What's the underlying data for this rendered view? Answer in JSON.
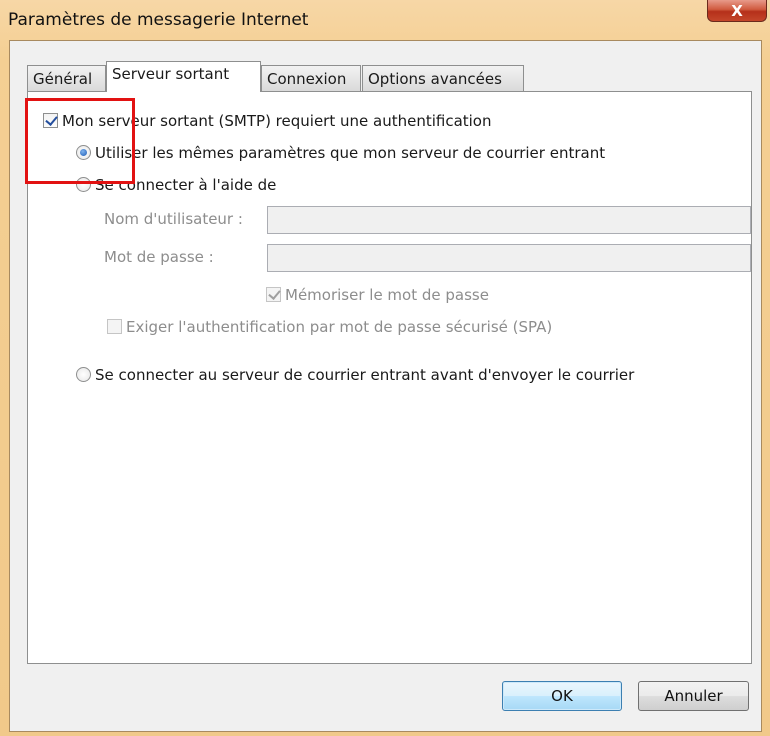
{
  "window": {
    "title": "Paramètres de messagerie Internet",
    "close_label": "X"
  },
  "tabs": [
    {
      "label": "Général",
      "active": false
    },
    {
      "label": "Serveur sortant",
      "active": true
    },
    {
      "label": "Connexion",
      "active": false
    },
    {
      "label": "Options avancées",
      "active": false
    }
  ],
  "outgoing": {
    "require_auth_label": "Mon serveur sortant (SMTP) requiert une authentification",
    "require_auth_checked": true,
    "same_settings_label": "Utiliser les mêmes paramètres que mon serveur de courrier entrant",
    "same_settings_selected": true,
    "connect_with_label": "Se connecter à l'aide de",
    "connect_with_selected": false,
    "username_label": "Nom d'utilisateur :",
    "username_value": "",
    "password_label": "Mot de passe :",
    "password_value": "",
    "remember_password_label": "Mémoriser le mot de passe",
    "remember_password_checked": true,
    "spa_label": "Exiger l'authentification par mot de passe sécurisé (SPA)",
    "spa_checked": false,
    "connect_incoming_first_label": "Se connecter au serveur de courrier entrant avant d'envoyer le courrier",
    "connect_incoming_first_selected": false
  },
  "buttons": {
    "ok_label": "OK",
    "cancel_label": "Annuler"
  },
  "colors": {
    "title_bar": "#f1c98a",
    "close_button": "#c4462a",
    "highlight_box": "#e21212",
    "check_mark": "#244f9e"
  }
}
